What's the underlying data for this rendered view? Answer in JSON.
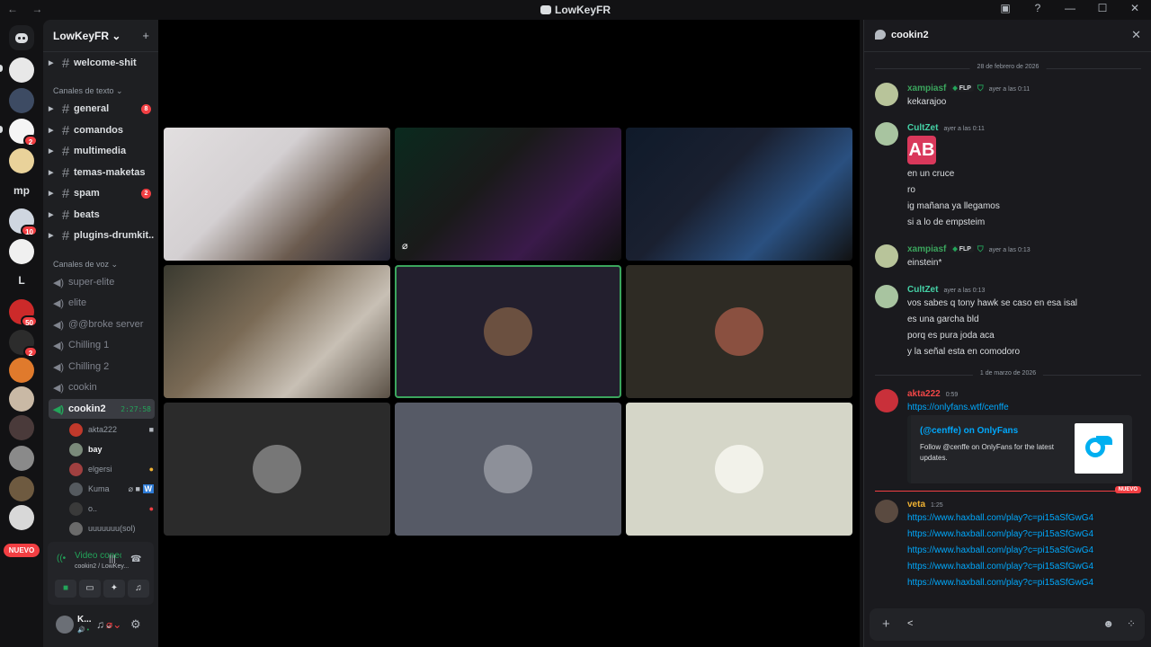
{
  "window": {
    "title": "LowKeyFR",
    "nav": "← →"
  },
  "rail": {
    "dm_icon": "discord-logo-icon",
    "badges": {
      "s3": "2",
      "s6": "10",
      "s10": "50",
      "s11": "2"
    },
    "text_servers": {
      "mp": "mp",
      "l": "L"
    },
    "nuevo": "NUEVO"
  },
  "server": {
    "name": "LowKeyFR ⌄",
    "invite_icon": "person-add-icon"
  },
  "channels": {
    "pinned": {
      "label": "welcome-shit"
    },
    "text_category": "Canales de texto ⌄",
    "text": [
      {
        "label": "general",
        "count": "8"
      },
      {
        "label": "comandos"
      },
      {
        "label": "multimedia"
      },
      {
        "label": "temas-maketas"
      },
      {
        "label": "spam",
        "count": "2"
      },
      {
        "label": "beats"
      },
      {
        "label": "plugins-drumkit..."
      }
    ],
    "voice_category": "Canales de voz ⌄",
    "voice": [
      {
        "label": "super-elite"
      },
      {
        "label": "elite"
      },
      {
        "label": "@@broke server"
      },
      {
        "label": "Chilling 1"
      },
      {
        "label": "Chilling 2"
      },
      {
        "label": "cookin"
      },
      {
        "label": "cookin2",
        "time": "2:27:58"
      }
    ],
    "members": [
      {
        "name": "akta222",
        "icon": "video-camera-icon"
      },
      {
        "name": "bay"
      },
      {
        "name": "elgersi",
        "icon": "emoji-badge-icon"
      },
      {
        "name": "Kuma",
        "icon": "muted-video-w-icons"
      },
      {
        "name": "o..",
        "icon": "red-status-icon"
      },
      {
        "name": "uuuuuuu(sol)"
      }
    ]
  },
  "voice_panel": {
    "status": "Video conectado",
    "sub": "cookin2 / LowKey...",
    "signal_icon": "signal-icon",
    "buttons": [
      "camera-icon",
      "screen-share-icon",
      "activities-icon",
      "soundboard-icon"
    ]
  },
  "user": {
    "name": "K...",
    "status": "🔊 •"
  },
  "chat": {
    "title": "cookin2",
    "date1": "28 de febrero de 2026",
    "date2": "1 de marzo de 2026",
    "msgs": {
      "m1": {
        "author": "xampiasf",
        "tag": "FLP",
        "time": "ayer a las 0:11",
        "lines": [
          "kekarajoo"
        ]
      },
      "m2": {
        "author": "CultZet",
        "time": "ayer a las 0:11",
        "emoji": "AB",
        "lines": [
          "en un cruce",
          "ro",
          "ig mañana ya llegamos",
          "si a lo de empsteim"
        ]
      },
      "m3": {
        "author": "xampiasf",
        "tag": "FLP",
        "time": "ayer a las 0:13",
        "lines": [
          "einstein*"
        ]
      },
      "m4": {
        "author": "CultZet",
        "time": "ayer a las 0:13",
        "lines": [
          "vos sabes q tony hawk se caso en esa isal",
          "es una garcha bld",
          "porq es pura joda aca",
          "y la señal esta en comodoro"
        ]
      },
      "m5": {
        "author": "akta222",
        "time": "0:59",
        "link": "https://onlyfans.wtf/cenffe"
      },
      "m6": {
        "author": "veta",
        "time": "1:25",
        "links": [
          "https://www.haxball.com/play?c=pi15aSfGwG4",
          "https://www.haxball.com/play?c=pi15aSfGwG4",
          "https://www.haxball.com/play?c=pi15aSfGwG4",
          "https://www.haxball.com/play?c=pi15aSfGwG4",
          "https://www.haxball.com/play?c=pi15aSfGwG4"
        ]
      }
    },
    "embed": {
      "title": "(@cenffe) on OnlyFans",
      "desc": "Follow @cenffe on OnlyFans for the latest updates."
    },
    "new_label": "NUEVO",
    "composer_value": "<"
  },
  "colors": {
    "accent_green": "#23a55a",
    "link": "#00a8fc",
    "author_green": "#3ba55d",
    "author_teal": "#45d1a6",
    "author_red": "#f04747",
    "author_yellow": "#f0b232",
    "alert_red": "#f23f43"
  }
}
